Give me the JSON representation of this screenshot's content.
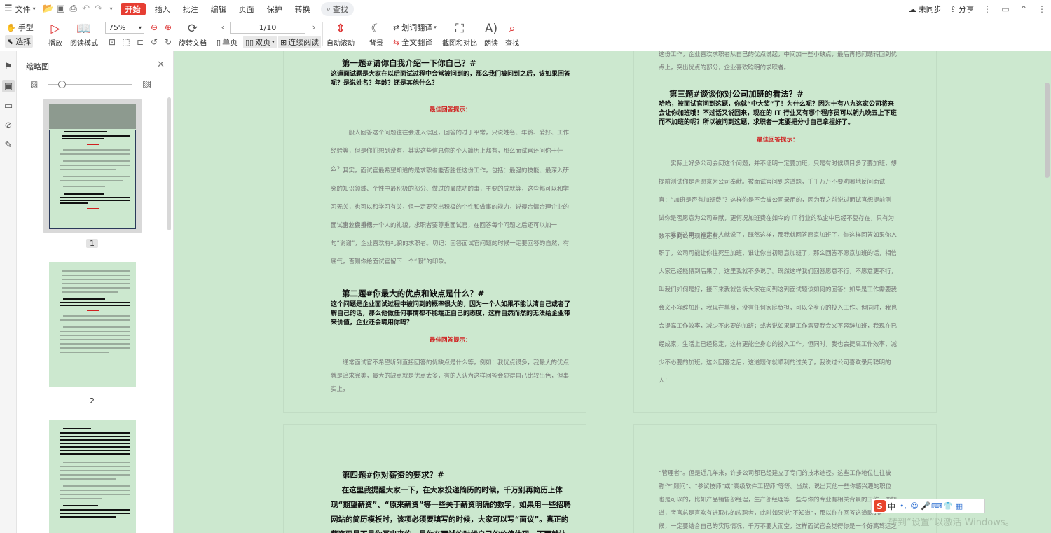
{
  "menubar": {
    "file": "文件",
    "tabs": [
      "开始",
      "插入",
      "批注",
      "编辑",
      "页面",
      "保护",
      "转换"
    ],
    "active_tab": "开始",
    "search": "查找",
    "sync": "未同步",
    "share": "分享"
  },
  "ribbon": {
    "hand": "手型",
    "select": "选择",
    "play": "播放",
    "read_mode": "阅读模式",
    "zoom": "75%",
    "rotate": "旋转文档",
    "page_display": "1/10",
    "single": "单页",
    "double": "双页",
    "continuous": "连续阅读",
    "auto_scroll": "自动滚动",
    "background": "背景",
    "word_translate": "划词翻译",
    "full_translate": "全文翻译",
    "screenshot_compare": "截图和对比",
    "read_aloud": "朗读",
    "find": "查找"
  },
  "sidebar": {
    "title": "缩略图",
    "thumbnails": [
      {
        "num": "1",
        "selected": true
      },
      {
        "num": "2",
        "selected": false
      }
    ]
  },
  "document": {
    "q1_title": "第一题#请你自我介绍一下你自己？#",
    "q1_question": "这道面试题是大家在以后面试过程中会常被问到的，那么我们被问到之后，该如果回答呢？是说姓名？年龄？还是其他什么？",
    "hint_label": "最佳回答提示：",
    "q1_paras": [
      "一般人回答这个问题往往会进入误区，回答的过于平常，只说姓名、年龄、爱好、工作经验等，但是你们想到没有，其实这些信息你的个人简历上都有，那么面试官还问你干什么？",
      "其实，面试官最希望知道的是求职者能否胜任这份工作，包括：最强的技能、最深入研究的知识领域、个性中最积极的部分、做过的最成功的事，主要的成就等，这些都可以和学习无关，也可以和学习有关，但一定要突出积极的个性和做事的能力，说得合情合理企业的面试官才会相信。",
      "企业很重视一个人的礼貌，求职者要尊重面试官，在回答每个问题之后还可以加一句“谢谢”，企业喜欢有礼貌的求职者。切记：回答面试官问题的时候一定要回答的自然，有底气，否则你给面试官留下一个“假”的印象。"
    ],
    "q2_title": "第二题#你最大的优点和缺点是什么？#",
    "q2_question": "这个问题是企业面试过程中被问到的概率很大的，因为一个人如果不能认清自己或者了解自己的话，那么他做任何事情都不能端正自己的态度，这样自然而然的无法给企业带来价值，企业还会聘用你吗？",
    "q2_para": "通常面试官不希望听到直接回答的优缺点是什么等，例如：我优点很多，我最大的优点就是追求完美，最大的缺点就是优点太多，有的人认为这样回答会显得自己比较出色，但事实上，",
    "right_top": "这份工作，企业喜欢求职者从自己的优点说起，中间加一些小缺点，最后再把问题转回到优点上，突出优点的部分，企业喜欢聪明的求职者。",
    "q3_title": "第三题#谈谈你对公司加班的看法？#",
    "q3_question": "哈哈，被面试官问到这题，你就“中大奖”了！为什么呢？因为十有八九这家公司将来会让你加班哦！不过话又说回来，现在的 IT 行业又有哪个程序员可以朝九晚五上下班而不加班的呢？所以被问到这题，求职者一定要把分寸自己拿捏好了。",
    "q3_paras": [
      "实际上好多公司会问这个问题，并不证明一定要加班，只是有时候项目多了要加班，想提前测试你是否愿意为公司奉献。被面试官问到这道题，千千万万不要劝哪地反问面试官：“加班是否有加班费”？这样你是不会被公司录用的，因为我之前说过面试官想提前测试你是否愿意为公司奉献，更何况加班费在如今的 IT 行业的私企中已经不复存在，只有为数不多的公司现在还有。",
      "看到这里，肯定有人就说了，既然这样，那我就回答愿意加班了，你这样回答如果你入职了，公司可能让你往死里加班，谁让你当初愿意加班了，那么回答不愿意加班的话，相信大家已经能猜到后果了，这里我就不多说了。既然这样我们回答愿意不行，不愿意更不行，叫我们如何是好，接下来我就告诉大家在问到这到面试题该如何的回答：如果是工作需要我会义不容辞加班，我现在单身，没有任何家庭负担，可以全身心的投入工作。但同时，我也会提高工作效率，减少不必要的加班；或者说如果是工作需要我会义不容辞加班，我现在已经成家，生活上已经稳定，这样更能全身心的投入工作。但同时，我也会提高工作效率，减少不必要的加班。这么回答之后，这道题你就顺利的过关了，我说过公司喜欢录用聪明的人！"
    ],
    "q4_title": "第四题#你对薪资的要求？#",
    "q4_para": "在这里我提醒大家一下，在大家投递简历的时候，千万别再简历上体现“期望薪资”、“原来薪资”等一些关于薪资明确的数字，如果用一些招聘网站的简历模板时，该项必须要填写的时候，大家可以写“面议”。真正的薪资要是不是你写出来的，是你在面试的时候自己的价值体现，下面就让播妞告诉大家如何在面试的时",
    "right_bottom": "“管理者”。但是近几年来，许多公司都已经建立了专门的技术途径。这些工作地位往往被称作“顾问”、“参议技师”或“高级软件工程师”等等。当然，说出其他一些你感兴趣的职位也是可以的，比如产品销售部经理，生产部经理等一些与你的专业有相关背景的工作。要知道，考官总是喜欢有进取心的应聘者，此时如果说“不知道”，那以你在回答这道题的时候，一定要结合自己的实际情况，千万不要大而空，这样面试官会觉得你是一个好高骛远之人。就会使你丧失一个好机会。"
  },
  "overlay": {
    "ime_text": "中",
    "watermark": "转到“设置”以激活 Windows。"
  },
  "colors": {
    "page_bg": "#cce8cf",
    "accent_red": "#e63e33",
    "hint_red": "#d02020"
  }
}
